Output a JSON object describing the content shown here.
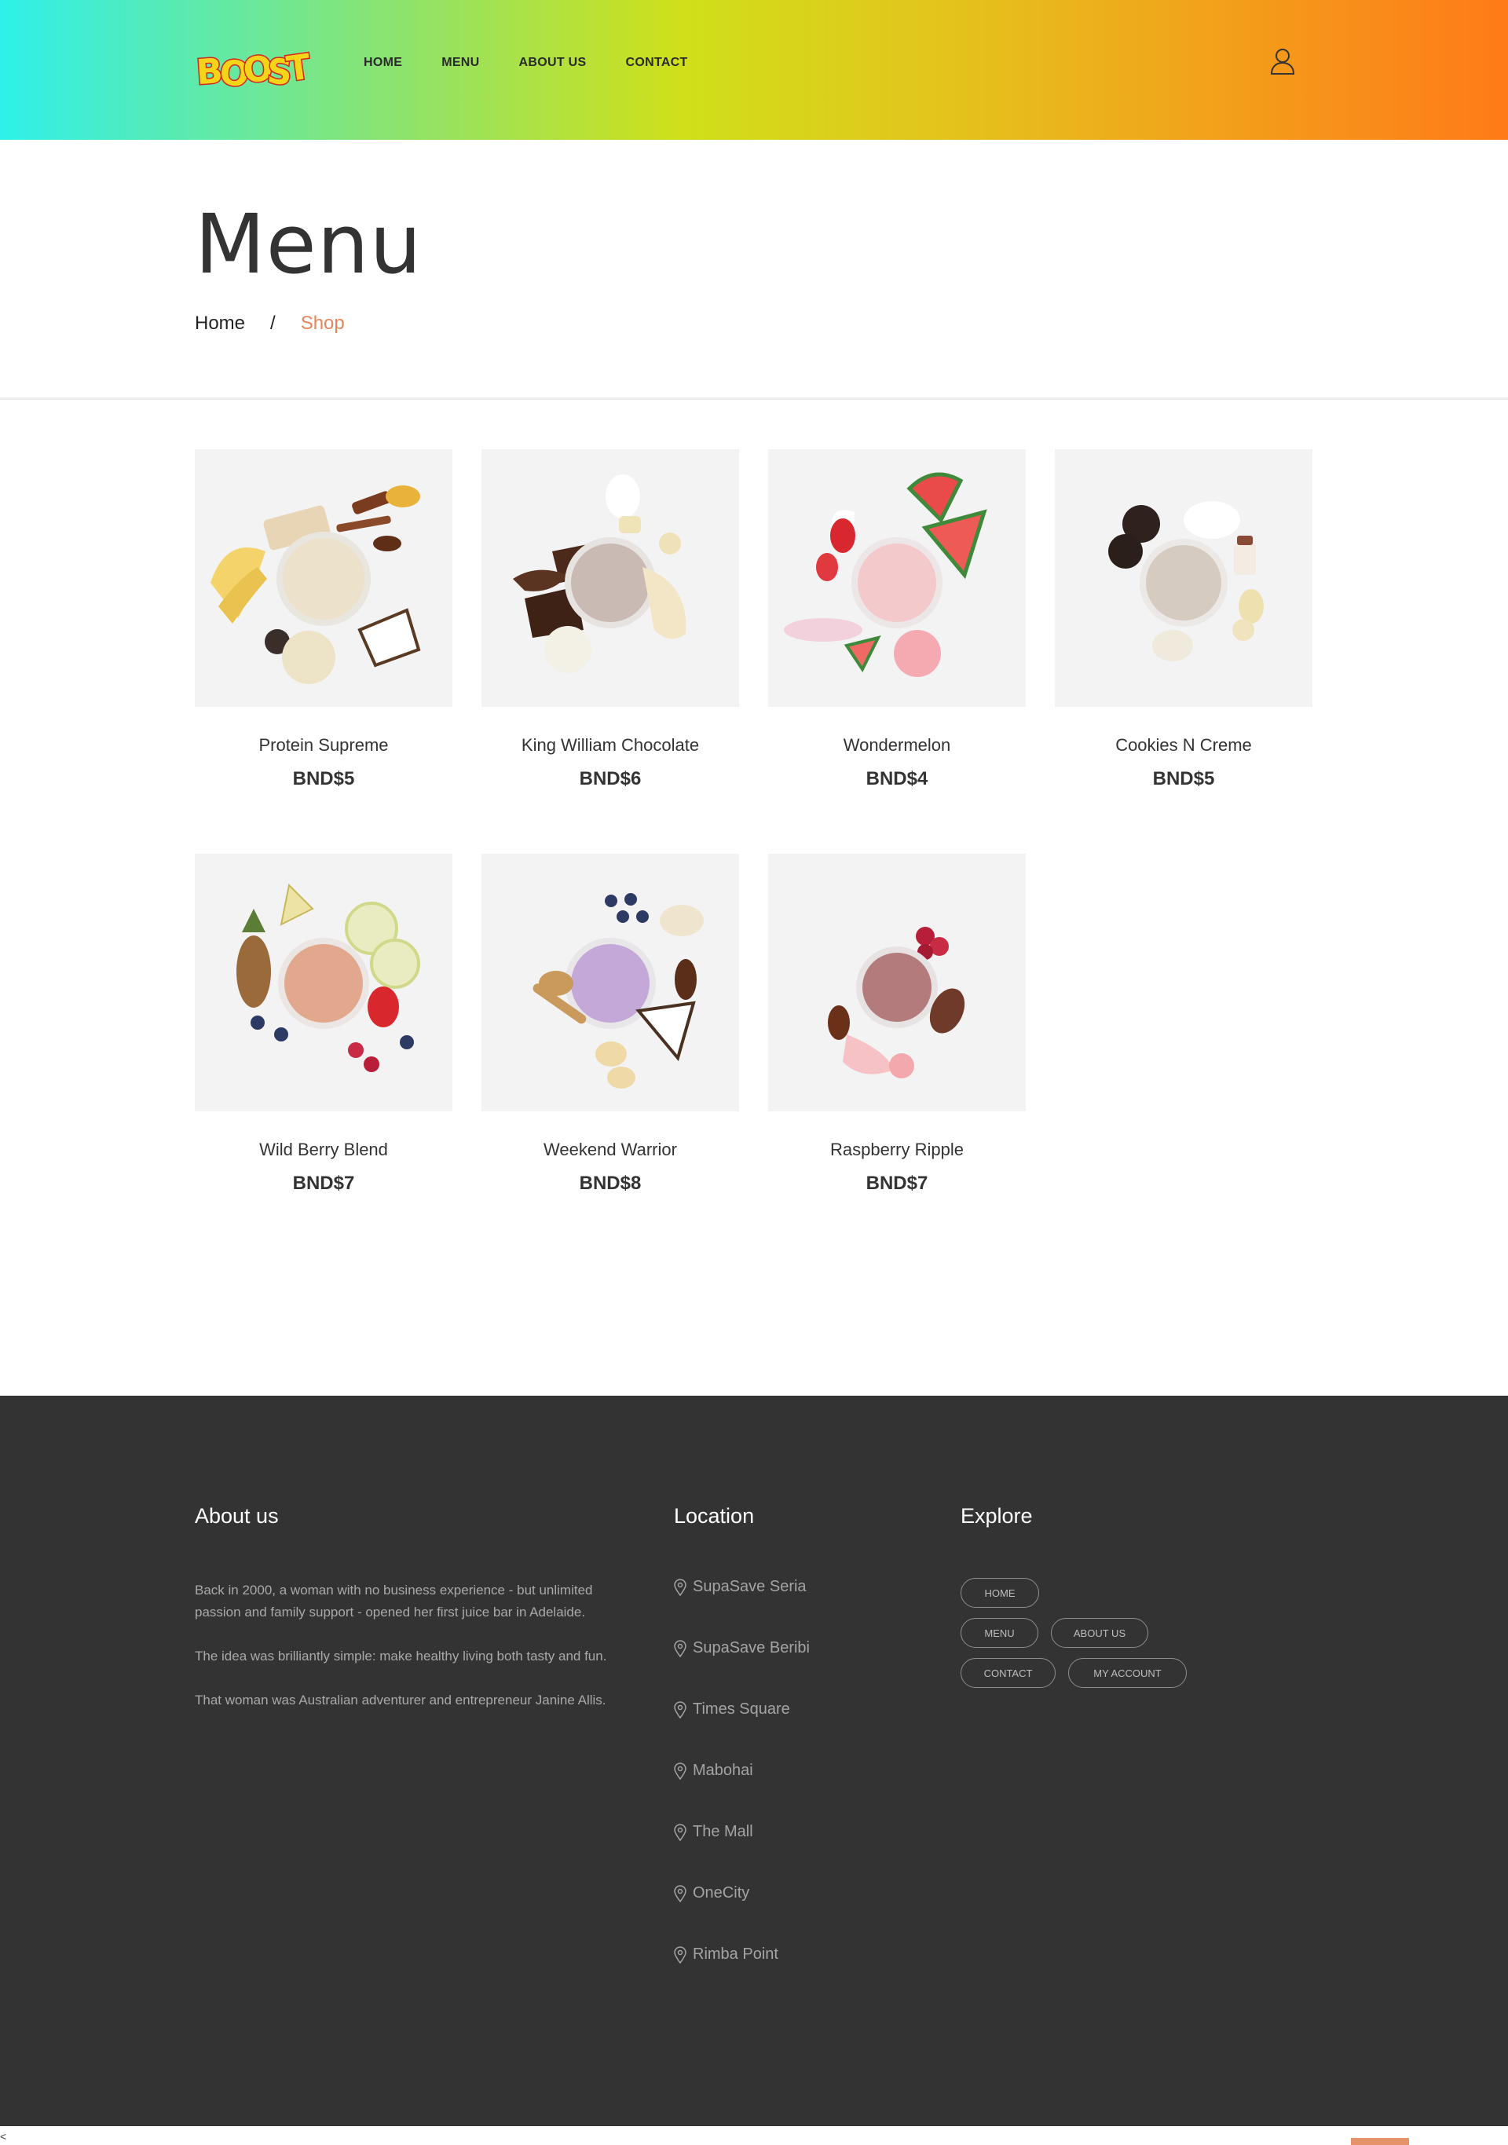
{
  "header": {
    "logo_text": "BOOST",
    "nav": [
      "HOME",
      "MENU",
      "ABOUT US",
      "CONTACT"
    ],
    "account_icon": "user-icon"
  },
  "page": {
    "title": "Menu",
    "breadcrumb": {
      "home": "Home",
      "separator": "/",
      "current": "Shop"
    }
  },
  "products": [
    {
      "name": "Protein Supreme",
      "price": "BND$5"
    },
    {
      "name": "King William Chocolate",
      "price": "BND$6"
    },
    {
      "name": "Wondermelon",
      "price": "BND$4"
    },
    {
      "name": "Cookies N Creme",
      "price": "BND$5"
    },
    {
      "name": "Wild Berry Blend",
      "price": "BND$7"
    },
    {
      "name": "Weekend Warrior",
      "price": "BND$8"
    },
    {
      "name": "Raspberry Ripple",
      "price": "BND$7"
    }
  ],
  "footer": {
    "about": {
      "heading": "About us",
      "paragraphs": [
        "Back in 2000, a woman with no business experience - but unlimited passion and family support - opened her first juice bar in Adelaide.",
        "The idea was brilliantly simple: make healthy living both tasty and fun.",
        "That woman was Australian adventurer and entrepreneur Janine Allis."
      ]
    },
    "location": {
      "heading": "Location",
      "items": [
        "SupaSave Seria",
        "SupaSave Beribi",
        "Times Square",
        "Mabohai",
        "The Mall",
        "OneCity",
        "Rimba Point"
      ]
    },
    "explore": {
      "heading": "Explore",
      "tags": [
        "HOME",
        "MENU",
        "ABOUT US",
        "CONTACT",
        "MY ACCOUNT"
      ]
    }
  },
  "misc": {
    "corner_glyph": "<"
  },
  "colors": {
    "accent": "#e8845a",
    "footer_bg": "#333333",
    "footer_text": "#a9a9a9"
  }
}
